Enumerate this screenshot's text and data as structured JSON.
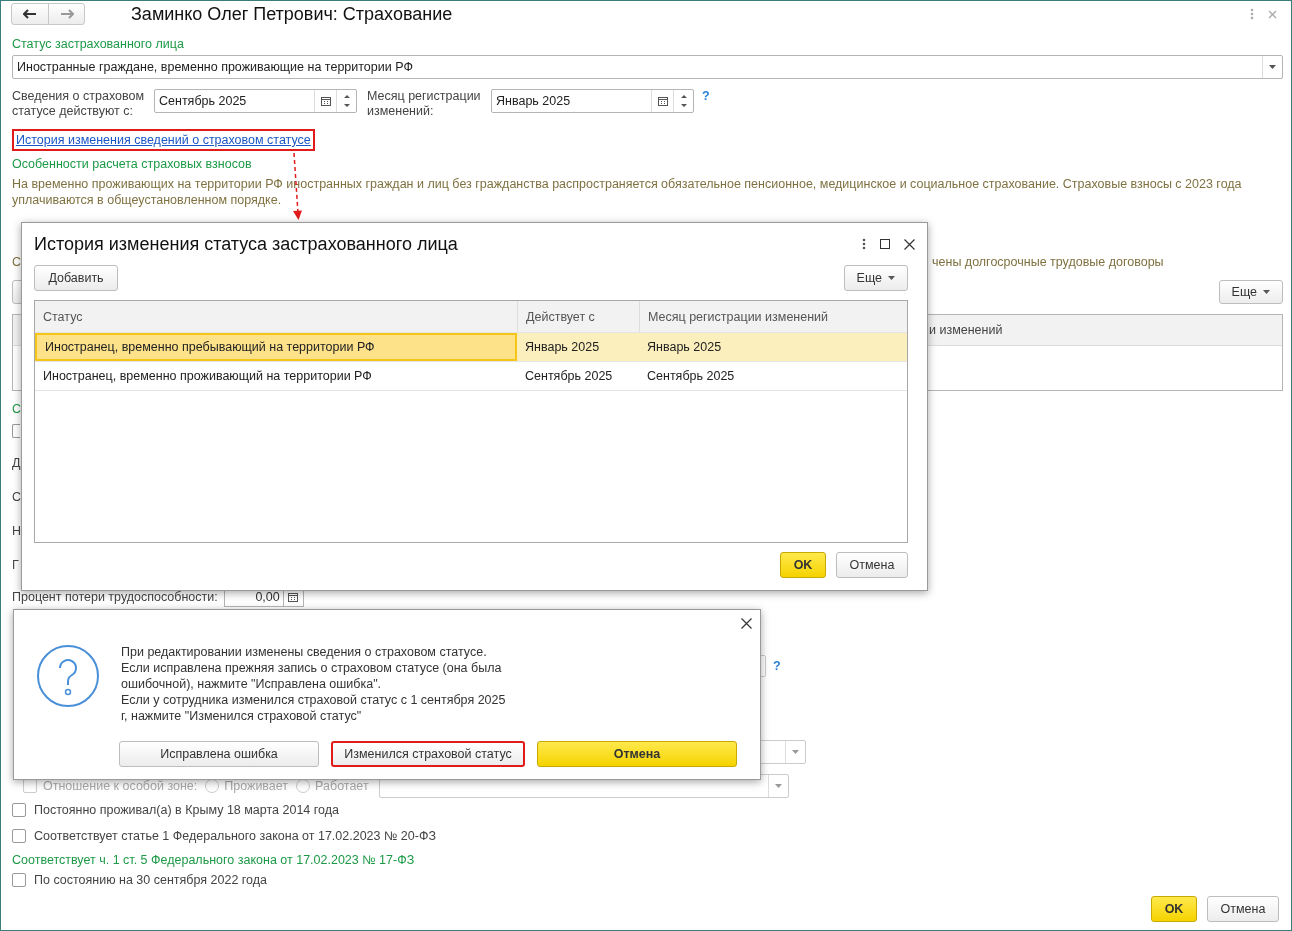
{
  "window": {
    "title": "Заминко Олег Петрович: Страхование"
  },
  "insured_status": {
    "label": "Статус застрахованного лица",
    "value": "Иностранные граждане, временно проживающие на территории РФ"
  },
  "effective_from": {
    "label": "Сведения о страховом статусе действуют с:",
    "value": "Сентябрь 2025"
  },
  "registration_month": {
    "label": "Месяц регистрации изменений:",
    "value": "Январь 2025",
    "help": "?"
  },
  "history_link": {
    "text": "История изменения сведений о страховом статусе",
    "highlighted": true
  },
  "features": {
    "title": "Особенности расчета страховых взносов",
    "text": "На временно проживающих на территории РФ иностранных граждан и лиц без гражданства распространяется обязательное пенсионное, медицинское и социальное страхование. Страховые взносы с 2023 года уплачиваются в общеустановленном порядке."
  },
  "contracts_row": {
    "left": "С",
    "right": "чены долгосрочные трудовые договоры"
  },
  "table_toolbar": {
    "more_button": "Еще"
  },
  "covered_table": {
    "column_fragment": "и изменений"
  },
  "left_fragments": [
    {
      "kind": "heading",
      "text": "С"
    },
    {
      "kind": "checkbox",
      "checked": false
    },
    {
      "kind": "label",
      "text": "Д"
    },
    {
      "kind": "label",
      "text": "С"
    },
    {
      "kind": "label",
      "text": "Н"
    },
    {
      "kind": "label",
      "text": "Г"
    }
  ],
  "disability": {
    "label": "Процент потери трудоспособности:",
    "value": "0,00"
  },
  "covered_field_help": "?",
  "special_zone": {
    "label": "Отношение к особой зоне:",
    "checked": false,
    "disabled": true,
    "options": [
      {
        "label": "Проживает",
        "selected": false
      },
      {
        "label": "Работает",
        "selected": false
      }
    ]
  },
  "checkboxes": [
    {
      "label": "Постоянно проживал(а) в Крыму 18 марта 2014 года",
      "checked": false
    },
    {
      "label": "Соответствует статье 1 Федерального закона от 17.02.2023 № 20-ФЗ",
      "checked": false
    }
  ],
  "law_section": {
    "title": "Соответствует ч. 1 ст. 5 Федерального закона от 17.02.2023 № 17-ФЗ",
    "checkboxes": [
      {
        "label": "По состоянию на 30 сентября 2022 года",
        "checked": false
      }
    ]
  },
  "footer_buttons": [
    {
      "label": "OK",
      "kind": "primary"
    },
    {
      "label": "Отмена",
      "kind": "default"
    }
  ],
  "history_dialog": {
    "title": "История изменения статуса застрахованного лица",
    "add_button": "Добавить",
    "more_button": "Еще",
    "columns": [
      "Статус",
      "Действует с",
      "Месяц регистрации изменений"
    ],
    "rows": [
      {
        "cells": [
          "Иностранец, временно пребывающий на территории РФ",
          "Январь 2025",
          "Январь 2025"
        ],
        "selected": true
      },
      {
        "cells": [
          "Иностранец, временно проживающий на территории РФ",
          "Сентябрь 2025",
          "Сентябрь 2025"
        ],
        "selected": false
      }
    ],
    "buttons": [
      {
        "label": "OK",
        "kind": "primary"
      },
      {
        "label": "Отмена",
        "kind": "default"
      }
    ]
  },
  "question_dialog": {
    "text": "При редактировании изменены сведения о страховом статусе.\nЕсли исправлена прежняя запись о страховом статусе (она была ошибочной), нажмите \"Исправлена ошибка\".\nЕсли у сотрудника изменился страховой статус с 1 сентября 2025 г, нажмите \"Изменился страховой статус\"",
    "buttons": [
      {
        "label": "Исправлена ошибка",
        "kind": "default",
        "highlighted": false
      },
      {
        "label": "Изменился страховой статус",
        "kind": "default",
        "highlighted": true
      },
      {
        "label": "Отмена",
        "kind": "primary",
        "highlighted": false
      }
    ]
  }
}
